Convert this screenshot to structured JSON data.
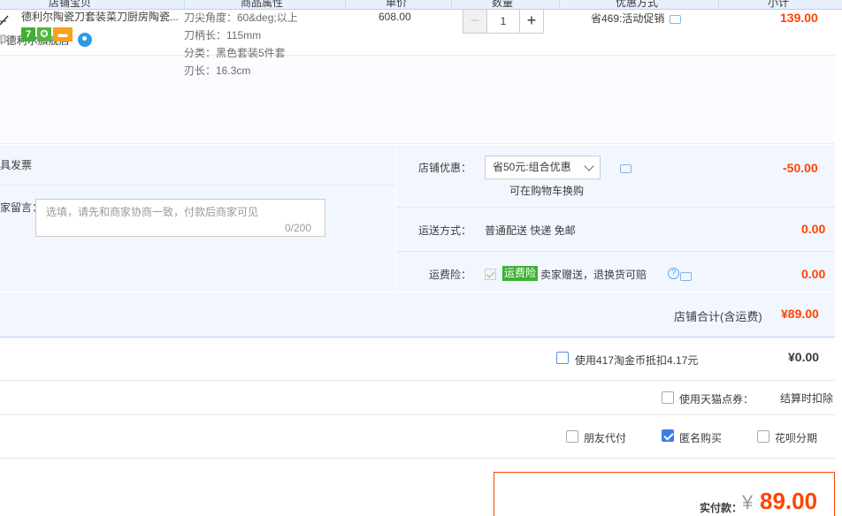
{
  "header": {
    "columns": [
      "店铺宝贝",
      "商品属性",
      "单价",
      "数量",
      "优惠方式",
      "小计"
    ]
  },
  "shop": {
    "name": ": 德利尔旗舰店"
  },
  "item": {
    "title": "德利尔陶瓷刀套装菜刀厨房陶瓷...",
    "badges": [
      "7",
      "cert",
      "card"
    ],
    "attributes": [
      "刀尖角度：60&deg;以上",
      "刀柄长：115mm",
      "分类：黑色套装5件套",
      "刃长：16.3cm"
    ],
    "unit_price": "608.00",
    "quantity": "1",
    "minus": "−",
    "plus": "+",
    "promotion": "省469:活动促销",
    "subtotal": "139.00"
  },
  "invoice": {
    "label": "具发票"
  },
  "message": {
    "label": "家留言：",
    "placeholder": "选填，请先和商家协商一致，付款后商家可见",
    "count": "0/200"
  },
  "shop_discount": {
    "label": "店铺优惠：",
    "selected": "省50元:组合优惠",
    "sub_note": "可在购物车换购",
    "value": "-50.00"
  },
  "shipping": {
    "label": "运送方式：",
    "method": "普通配送 快递 免邮",
    "price": "0.00"
  },
  "insurance": {
    "label": "运费险：",
    "tag": "运费险",
    "text": "卖家赠送，退换货可赔",
    "help": "?",
    "price": "0.00"
  },
  "shop_total": {
    "label": "店铺合计(含运费)",
    "value": "¥89.00"
  },
  "taobao_coin": {
    "text": "使用417淘金币抵扣4.17元",
    "value": "¥0.00"
  },
  "tmall_points": {
    "text": "使用天猫点券：",
    "right_text": "结算时扣除"
  },
  "options": {
    "friend_pay": "朋友代付",
    "anonymous": "匿名购买",
    "huabei": "花呗分期"
  },
  "payment": {
    "label": "实付款：",
    "currency": "¥",
    "amount": "89.00"
  }
}
